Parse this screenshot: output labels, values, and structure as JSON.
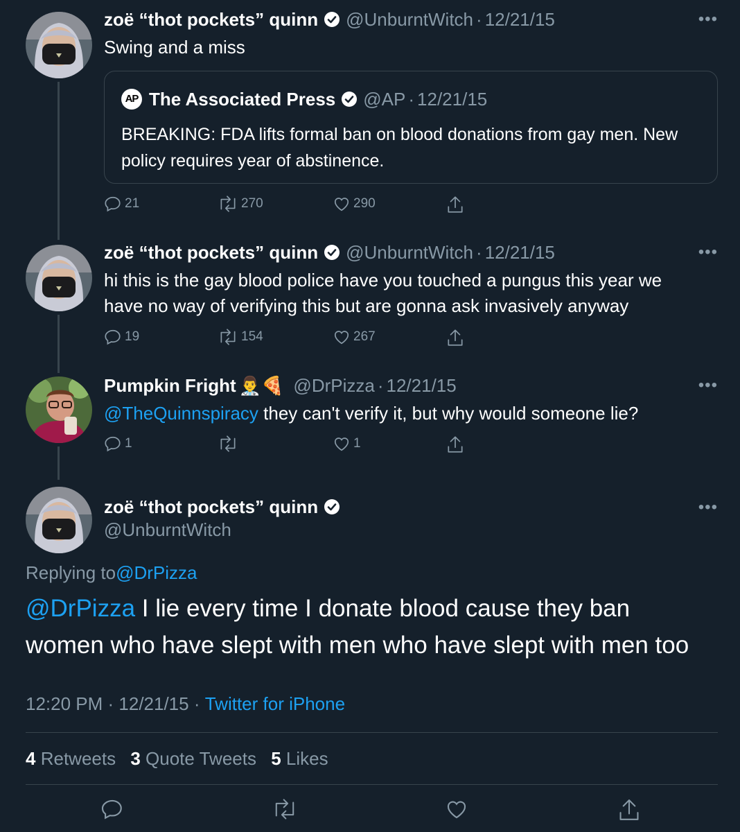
{
  "tweets": [
    {
      "name": "zoë “thot pockets” quinn",
      "handle": "@UnburntWitch",
      "sep": "·",
      "date": "12/21/15",
      "text": "Swing and a miss",
      "quote": {
        "logo_text": "AP",
        "name": "The Associated Press",
        "handle": "@AP",
        "sep": "·",
        "date": "12/21/15",
        "text": "BREAKING: FDA lifts formal ban on blood donations from gay men. New policy requires year of abstinence."
      },
      "replies": "21",
      "retweets": "270",
      "likes": "290"
    },
    {
      "name": "zoë “thot pockets” quinn",
      "handle": "@UnburntWitch",
      "sep": "·",
      "date": "12/21/15",
      "text": "hi this is the gay blood police have you touched a pungus this year we have no way of verifying this but are gonna ask invasively anyway",
      "replies": "19",
      "retweets": "154",
      "likes": "267"
    },
    {
      "name": "Pumpkin Fright",
      "emoji": "👨‍⚕️🍕",
      "handle": "@DrPizza",
      "sep": "·",
      "date": "12/21/15",
      "mention": "@TheQuinnspiracy",
      "text": " they can't verify it, but why would someone lie?",
      "replies": "1",
      "retweets": "",
      "likes": "1"
    }
  ],
  "main": {
    "name": "zoë “thot pockets” quinn",
    "handle": "@UnburntWitch",
    "replying_label": "Replying to ",
    "replying_to": "@DrPizza",
    "mention": "@DrPizza",
    "text": " I lie every time I donate blood cause they ban women who have slept with men who have slept with men too",
    "time": "12:20 PM · 12/21/15 · ",
    "source": "Twitter for iPhone",
    "stats": {
      "retweets_count": "4",
      "retweets_label": "Retweets",
      "quotes_count": "3",
      "quotes_label": "Quote Tweets",
      "likes_count": "5",
      "likes_label": "Likes"
    }
  },
  "more_glyph": "•••",
  "colors": {
    "background": "#15202b",
    "muted": "#8899a6",
    "link": "#1da1f2",
    "border": "#38444d"
  }
}
